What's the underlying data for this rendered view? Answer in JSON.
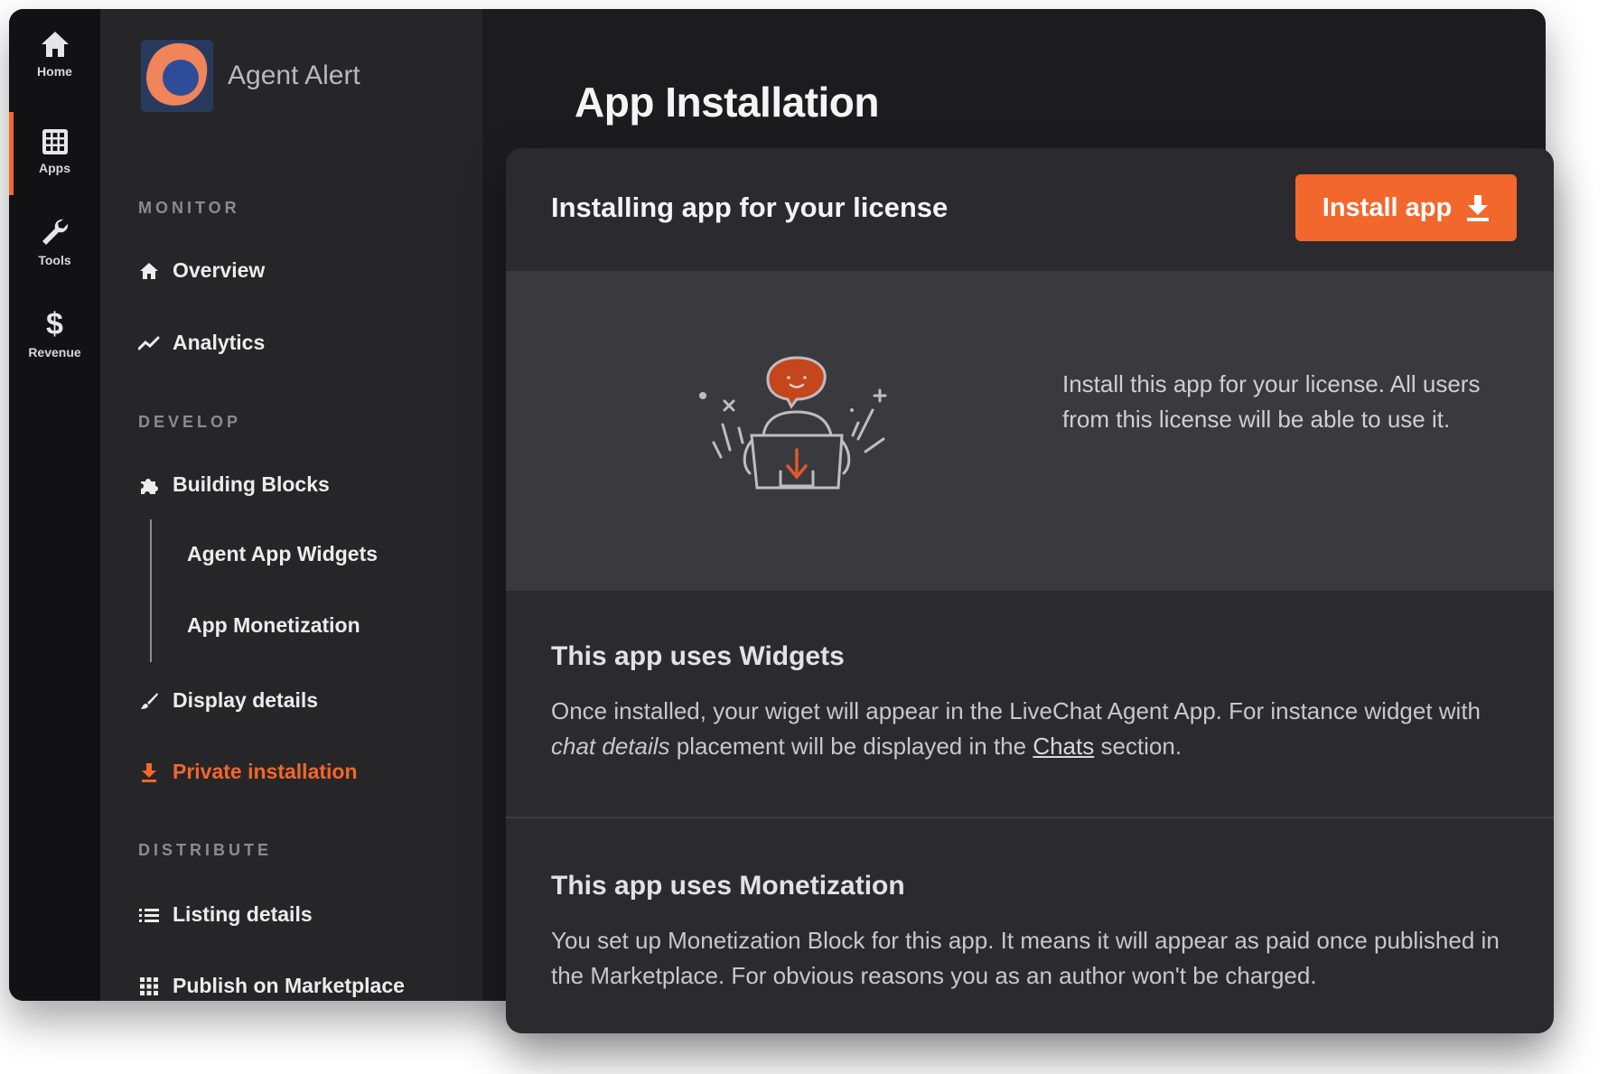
{
  "rail": {
    "items": [
      {
        "label": "Home",
        "icon": "home-icon"
      },
      {
        "label": "Apps",
        "icon": "apps-grid-icon"
      },
      {
        "label": "Tools",
        "icon": "wrench-icon"
      },
      {
        "label": "Revenue",
        "icon": "dollar-icon"
      }
    ],
    "revenue_symbol": "$",
    "active": "Apps"
  },
  "sidebar": {
    "app_name": "Agent Alert",
    "sections": {
      "monitor": "MONITOR",
      "develop": "DEVELOP",
      "distribute": "DISTRIBUTE"
    },
    "items": {
      "overview": "Overview",
      "analytics": "Analytics",
      "building_blocks": "Building Blocks",
      "agent_app_widgets": "Agent App Widgets",
      "app_monetization": "App Monetization",
      "display_details": "Display details",
      "private_installation": "Private installation",
      "listing_details": "Listing details",
      "publish_marketplace": "Publish on Marketplace"
    },
    "active_item": "Private installation"
  },
  "page": {
    "title": "App Installation"
  },
  "card": {
    "header_title": "Installing app for your license",
    "install_button": "Install app",
    "hero_text": "Install this app for your license. All users from this license will be able to use it.",
    "widgets": {
      "title": "This app uses Widgets",
      "body_part1": "Once installed, your wiget will appear in the LiveChat Agent App. For instance widget with ",
      "body_em": "chat details",
      "body_part2": " placement will be displayed in the ",
      "body_link": "Chats",
      "body_part3": " section."
    },
    "monetization": {
      "title": "This app uses Monetization",
      "body": "You set up Monetization Block for this app. It means it will appear as paid once published in the Marketplace. For obvious reasons you as an author won't be charged."
    }
  },
  "colors": {
    "accent": "#f2672c",
    "window_bg": "#1c1c1f",
    "rail_bg": "#121214",
    "sidebar_bg": "#262629",
    "card_bg": "#2b2b2f",
    "hero_bg": "#3a3a3e"
  }
}
